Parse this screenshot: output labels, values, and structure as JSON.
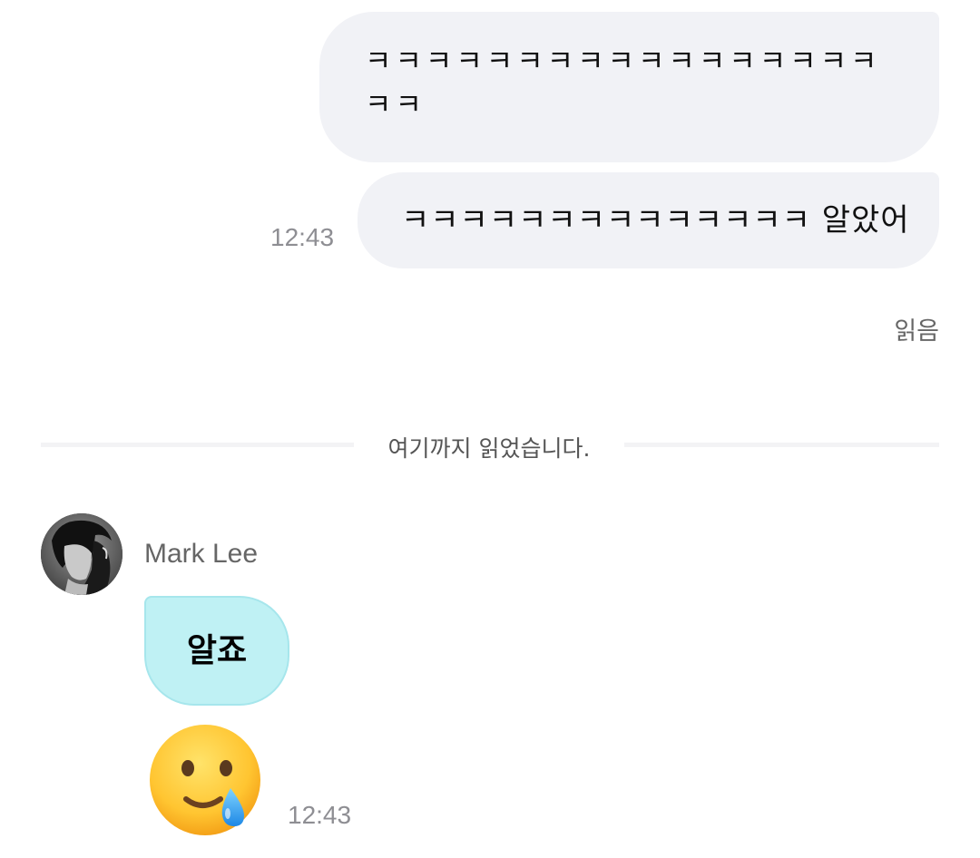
{
  "messages_out": [
    {
      "text": "ㅋㅋㅋㅋㅋㅋㅋㅋㅋㅋㅋㅋㅋㅋㅋㅋㅋㅋㅋ"
    },
    {
      "text": "ㅋㅋㅋㅋㅋㅋㅋㅋㅋㅋㅋㅋㅋㅋ 알았어",
      "time": "12:43"
    }
  ],
  "read_status": "읽음",
  "divider": {
    "label": "여기까지 읽었습니다."
  },
  "incoming": {
    "sender_name": "Mark Lee",
    "messages": [
      {
        "text": "알죠"
      },
      {
        "emoji": "smiling-face-with-tear-icon",
        "time": "12:43"
      }
    ]
  },
  "colors": {
    "bubble_out": "#f1f2f6",
    "bubble_in": "#bff1f4",
    "bubble_in_border": "#a6e6ec",
    "timestamp": "#8e8e93"
  }
}
